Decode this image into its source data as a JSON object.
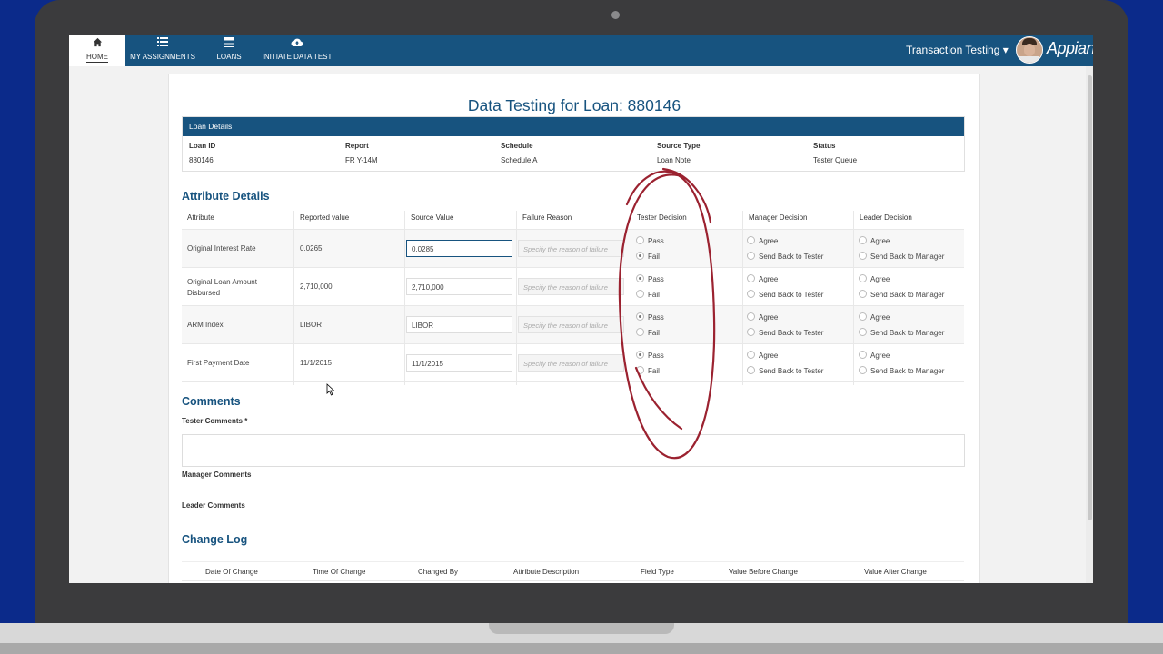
{
  "nav": {
    "items": [
      {
        "label": "HOME",
        "icon": "home-icon"
      },
      {
        "label": "MY ASSIGNMENTS",
        "icon": "list-icon"
      },
      {
        "label": "LOANS",
        "icon": "table-icon"
      },
      {
        "label": "INITIATE DATA TEST",
        "icon": "cloud-upload-icon"
      }
    ],
    "app_title": "Transaction Testing ▾",
    "logo": "Appian"
  },
  "page": {
    "title": "Data Testing for Loan: 880146"
  },
  "loan_details": {
    "header": "Loan Details",
    "columns": [
      {
        "label": "Loan ID",
        "value": "880146"
      },
      {
        "label": "Report",
        "value": "FR Y-14M"
      },
      {
        "label": "Schedule",
        "value": "Schedule A"
      },
      {
        "label": "Source Type",
        "value": "Loan Note"
      },
      {
        "label": "Status",
        "value": "Tester Queue"
      }
    ]
  },
  "attributes": {
    "title": "Attribute Details",
    "headers": [
      "Attribute",
      "Reported value",
      "Source Value",
      "Failure Reason",
      "Tester Decision",
      "Manager Decision",
      "Leader Decision"
    ],
    "failure_placeholder": "Specify the reason of failure",
    "tester_options": [
      "Pass",
      "Fail"
    ],
    "manager_options": [
      "Agree",
      "Send Back to Tester"
    ],
    "leader_options": [
      "Agree",
      "Send Back to Manager"
    ],
    "rows": [
      {
        "attribute": "Original Interest Rate",
        "reported": "0.0265",
        "source": "0.0285",
        "tester": "Fail"
      },
      {
        "attribute": "Original Loan Amount Disbursed",
        "reported": "2,710,000",
        "source": "2,710,000",
        "tester": "Pass"
      },
      {
        "attribute": "ARM Index",
        "reported": "LIBOR",
        "source": "LIBOR",
        "tester": "Pass"
      },
      {
        "attribute": "First Payment Date",
        "reported": "11/1/2015",
        "source": "11/1/2015",
        "tester": "Pass"
      }
    ]
  },
  "comments": {
    "title": "Comments",
    "tester_label": "Tester Comments *",
    "tester_value": "",
    "manager_label": "Manager Comments",
    "leader_label": "Leader Comments"
  },
  "change_log": {
    "title": "Change Log",
    "headers": [
      "Date Of Change",
      "Time Of Change",
      "Changed By",
      "Attribute Description",
      "Field Type",
      "Value Before Change",
      "Value After Change"
    ]
  },
  "colors": {
    "brand": "#17537f",
    "annotation": "#9b2230"
  }
}
